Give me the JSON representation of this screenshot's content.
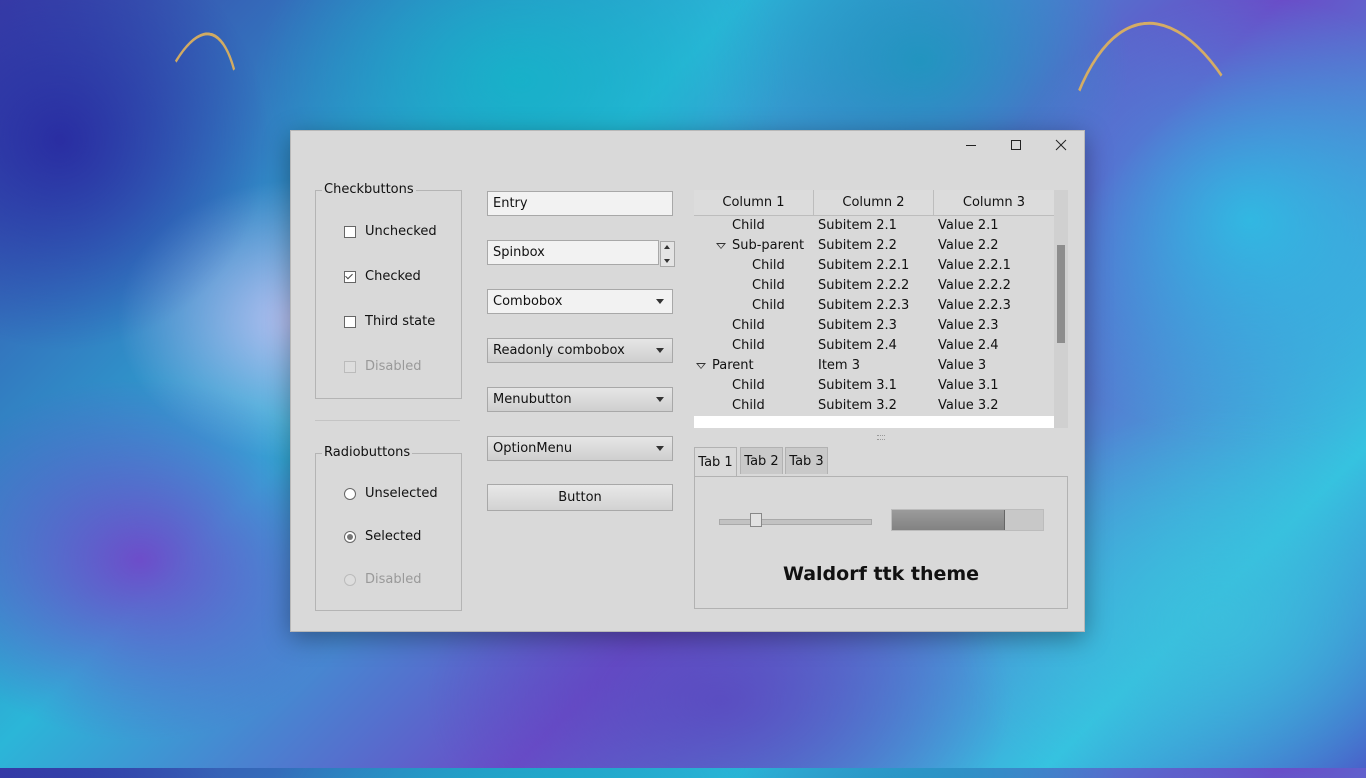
{
  "window": {
    "controls": {
      "minimize_icon": "minimize-icon",
      "maximize_icon": "maximize-icon",
      "close_icon": "close-icon"
    }
  },
  "checkbuttons": {
    "title": "Checkbuttons",
    "items": [
      {
        "label": "Unchecked",
        "state": "unchecked"
      },
      {
        "label": "Checked",
        "state": "checked"
      },
      {
        "label": "Third state",
        "state": "unchecked"
      },
      {
        "label": "Disabled",
        "state": "disabled"
      }
    ]
  },
  "radiobuttons": {
    "title": "Radiobuttons",
    "items": [
      {
        "label": "Unselected",
        "state": "unselected"
      },
      {
        "label": "Selected",
        "state": "selected"
      },
      {
        "label": "Disabled",
        "state": "disabled"
      }
    ]
  },
  "widgets": {
    "entry": "Entry",
    "spinbox": "Spinbox",
    "combobox": "Combobox",
    "readonly_combobox": "Readonly combobox",
    "menubutton": "Menubutton",
    "optionmenu": "OptionMenu",
    "button": "Button"
  },
  "tree": {
    "columns": [
      "Column 1",
      "Column 2",
      "Column 3"
    ],
    "rows": [
      {
        "c1": "Child",
        "c2": "Subitem 2.1",
        "c3": "Value 2.1"
      },
      {
        "c1": "Sub-parent",
        "c2": "Subitem 2.2",
        "c3": "Value 2.2",
        "expanded": true
      },
      {
        "c1": "Child",
        "c2": "Subitem 2.2.1",
        "c3": "Value 2.2.1"
      },
      {
        "c1": "Child",
        "c2": "Subitem 2.2.2",
        "c3": "Value 2.2.2"
      },
      {
        "c1": "Child",
        "c2": "Subitem 2.2.3",
        "c3": "Value 2.2.3"
      },
      {
        "c1": "Child",
        "c2": "Subitem 2.3",
        "c3": "Value 2.3"
      },
      {
        "c1": "Child",
        "c2": "Subitem 2.4",
        "c3": "Value 2.4"
      },
      {
        "c1": "Parent",
        "c2": "Item 3",
        "c3": "Value 3",
        "expanded": true
      },
      {
        "c1": "Child",
        "c2": "Subitem 3.1",
        "c3": "Value 3.1"
      },
      {
        "c1": "Child",
        "c2": "Subitem 3.2",
        "c3": "Value 3.2"
      }
    ]
  },
  "tabs": {
    "items": [
      "Tab 1",
      "Tab 2",
      "Tab 3"
    ],
    "active": "Tab 1"
  },
  "tab1": {
    "scale_value": 0.22,
    "progress_value": 0.74,
    "theme_label": "Waldorf ttk theme"
  }
}
